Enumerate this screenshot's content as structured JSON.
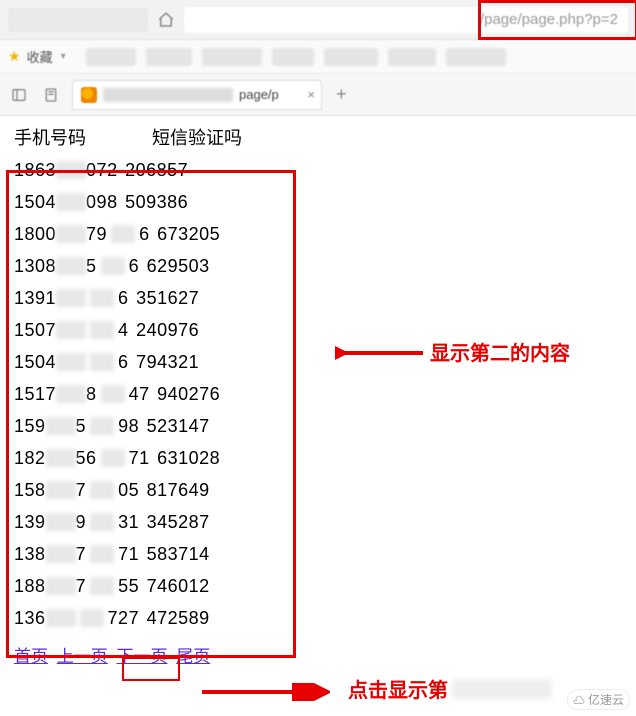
{
  "browser": {
    "url_visible": "/page/page.php?p=2",
    "bookmarks_label": "收藏",
    "tab": {
      "title_tail": "page/p",
      "close_glyph": "×"
    },
    "newtab_glyph": "+"
  },
  "table": {
    "headers": {
      "phone": "手机号码",
      "code": "短信验证吗"
    },
    "rows": [
      {
        "p1": "1863",
        "p2": "072",
        "code": "206857"
      },
      {
        "p1": "1504",
        "p2": "098",
        "code": "509386"
      },
      {
        "p1": "1800",
        "p2": "79",
        "p3": "6",
        "code": "673205"
      },
      {
        "p1": "1308",
        "p2": "5",
        "p3": "6",
        "code": "629503"
      },
      {
        "p1": "1391",
        "p2": "",
        "p3": "6",
        "code": "351627"
      },
      {
        "p1": "1507",
        "p2": "",
        "p3": "4",
        "code": "240976"
      },
      {
        "p1": "1504",
        "p2": "",
        "p3": "6",
        "code": "794321"
      },
      {
        "p1": "1517",
        "p2": "8",
        "p3": "47",
        "code": "940276"
      },
      {
        "p1": "159",
        "p2": "5",
        "p3": "98",
        "code": "523147"
      },
      {
        "p1": "182",
        "p2": "56",
        "p3": "71",
        "code": "631028"
      },
      {
        "p1": "158",
        "p2": "7",
        "p3": "05",
        "code": "817649"
      },
      {
        "p1": "139",
        "p2": "9",
        "p3": "31",
        "code": "345287"
      },
      {
        "p1": "138",
        "p2": "7",
        "p3": "71",
        "code": "583714"
      },
      {
        "p1": "188",
        "p2": "7",
        "p3": "55",
        "code": "746012"
      },
      {
        "p1": "136",
        "p2": "",
        "p3": "727",
        "code": "472589"
      }
    ]
  },
  "pager": {
    "first": "首页",
    "prev": "上一页",
    "next": "下一页",
    "last": "尾页"
  },
  "annotations": {
    "label1": "显示第二的内容",
    "label2": "点击显示第",
    "arrow_color": "#e60000"
  },
  "watermark": "亿速云"
}
